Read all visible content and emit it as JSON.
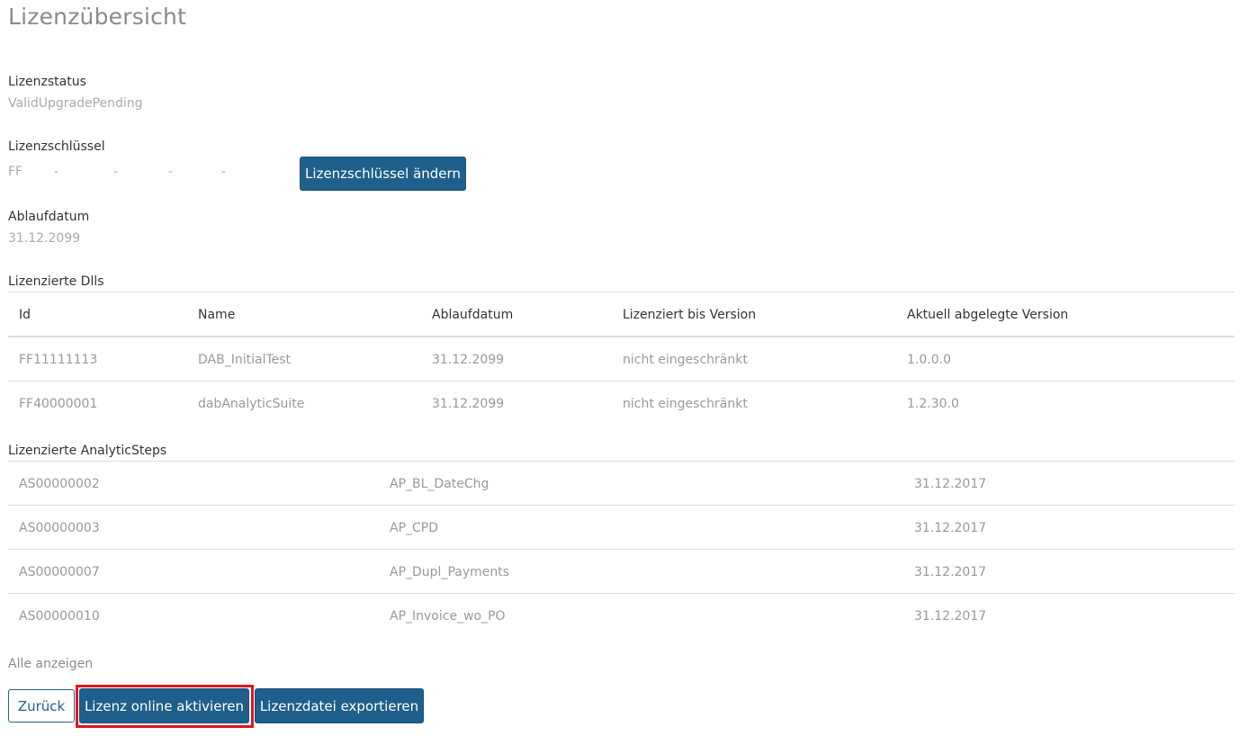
{
  "page": {
    "title": "Lizenzübersicht"
  },
  "status": {
    "label": "Lizenzstatus",
    "value": "ValidUpgradePending"
  },
  "license_key": {
    "label": "Lizenzschlüssel",
    "segments": [
      "FF",
      "-",
      "-",
      "-",
      "-"
    ],
    "change_button": "Lizenzschlüssel ändern"
  },
  "expiry": {
    "label": "Ablaufdatum",
    "value": "31.12.2099"
  },
  "dlls": {
    "section_label": "Lizenzierte Dlls",
    "headers": [
      "Id",
      "Name",
      "Ablaufdatum",
      "Lizenziert bis Version",
      "Aktuell abgelegte Version"
    ],
    "rows": [
      [
        "FF11111113",
        "DAB_InitialTest",
        "31.12.2099",
        "nicht eingeschränkt",
        "1.0.0.0"
      ],
      [
        "FF40000001",
        "dabAnalyticSuite",
        "31.12.2099",
        "nicht eingeschränkt",
        "1.2.30.0"
      ]
    ]
  },
  "steps": {
    "section_label": "Lizenzierte AnalyticSteps",
    "rows": [
      [
        "AS00000002",
        "AP_BL_DateChg",
        "31.12.2017"
      ],
      [
        "AS00000003",
        "AP_CPD",
        "31.12.2017"
      ],
      [
        "AS00000007",
        "AP_Dupl_Payments",
        "31.12.2017"
      ],
      [
        "AS00000010",
        "AP_Invoice_wo_PO",
        "31.12.2017"
      ]
    ],
    "show_all": "Alle anzeigen"
  },
  "actions": {
    "back": "Zurück",
    "activate_online": "Lizenz online aktivieren",
    "export_file": "Lizenzdatei exportieren"
  },
  "colors": {
    "primary_button": "#1f5f8b",
    "highlight_border": "#e0161e"
  }
}
